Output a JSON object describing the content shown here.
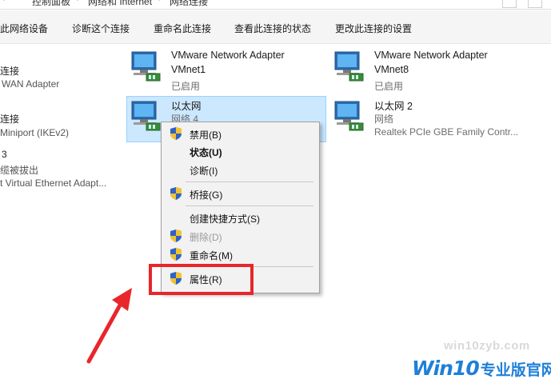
{
  "breadcrumb": {
    "items": [
      "控制面板",
      "网络和 Internet",
      "网络连接"
    ]
  },
  "toolbar": {
    "disable_device": "此网络设备",
    "diagnose": "诊断这个连接",
    "rename": "重命名此连接",
    "view_status": "查看此连接的状态",
    "change_settings": "更改此连接的设置"
  },
  "left_partial": {
    "a1_line1": "连接",
    "a1_line2": "WAN Adapter",
    "a2_line1": "连接",
    "a2_line2": "Miniport (IKEv2)",
    "a3_line1": "3",
    "a3_line2": "缆被拔出",
    "a3_line3": "t Virtual Ethernet Adapt..."
  },
  "adapters": {
    "vmnet1": {
      "name_line1": "VMware Network Adapter",
      "name_line2": "VMnet1",
      "status": "已启用"
    },
    "vmnet8": {
      "name_line1": "VMware Network Adapter",
      "name_line2": "VMnet8",
      "status": "已启用"
    },
    "ethernet": {
      "name": "以太网",
      "status": "网络  4"
    },
    "ethernet2": {
      "name": "以太网 2",
      "status": "网络",
      "device": "Realtek PCIe GBE Family Contr..."
    }
  },
  "context_menu": {
    "disable": "禁用(B)",
    "status": "状态(U)",
    "diagnose": "诊断(I)",
    "bridge": "桥接(G)",
    "create_shortcut": "创建快捷方式(S)",
    "delete": "删除(D)",
    "rename": "重命名(M)",
    "properties": "属性(R)"
  },
  "watermark": {
    "url": "win10zyb.com",
    "logo_win": "Win10",
    "logo_cn": "专业版官网"
  },
  "colors": {
    "selection_bg": "#cce8ff",
    "highlight_red": "#e8262b",
    "arrow_red": "#e8262b",
    "logo_blue": "#1f7fd8"
  }
}
